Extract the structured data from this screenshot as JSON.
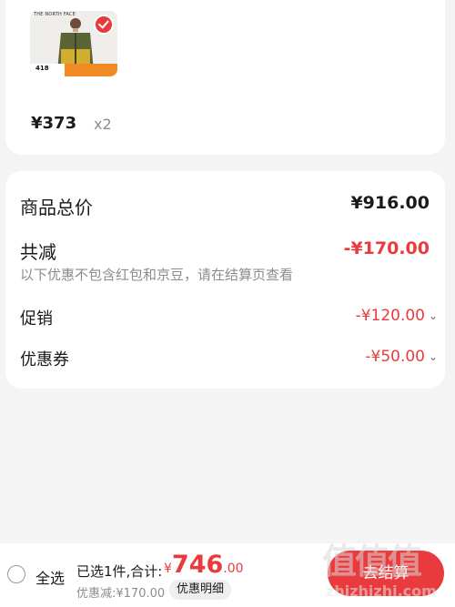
{
  "product": {
    "brand_on_image": "THE NORTH FACE",
    "image_price": "418",
    "unit_price": "¥373",
    "quantity": "x2",
    "selected_check_color": "#e93b3d"
  },
  "summary": {
    "goods_total_label": "商品总价",
    "goods_total_value": "¥916.00",
    "reduction_label": "共减",
    "reduction_value": "-¥170.00",
    "reduction_note": "以下优惠不包含红包和京豆，请在结算页查看",
    "promo_label": "促销",
    "promo_value": "-¥120.00",
    "coupon_label": "优惠券",
    "coupon_value": "-¥50.00",
    "chevron_icon": "chevron-down-icon"
  },
  "bottom_bar": {
    "select_all_label": "全选",
    "selected_text": "已选1件,合计:",
    "currency_symbol": "¥",
    "total_integer": "746",
    "total_decimal": ".00",
    "discount_text": "优惠减:¥170.00",
    "detail_button_label": "优惠明细",
    "checkout_button_label": "去结算",
    "accent_color": "#e93b3d"
  },
  "watermark": {
    "logo_text": "值值值",
    "url_text": "zhizhizhi.com"
  }
}
